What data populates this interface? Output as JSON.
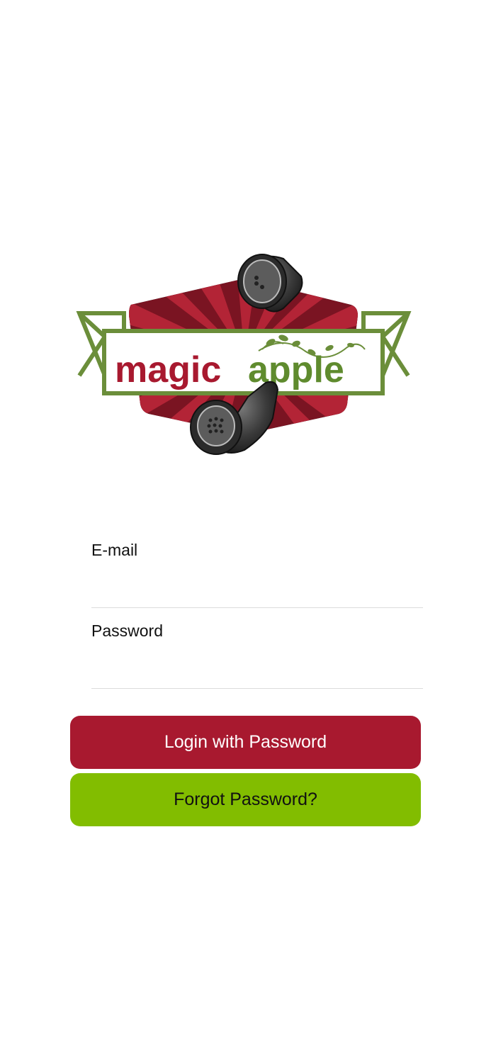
{
  "brand": {
    "logo_word_1": "magic",
    "logo_word_2": "apple",
    "colors": {
      "red": "#a8192f",
      "green": "#82bd00",
      "logo_green": "#6b8e3a",
      "logo_dark": "#2a3338"
    }
  },
  "form": {
    "email_label": "E-mail",
    "email_value": "",
    "password_label": "Password",
    "password_value": ""
  },
  "buttons": {
    "login_label": "Login with Password",
    "forgot_label": "Forgot Password?"
  }
}
